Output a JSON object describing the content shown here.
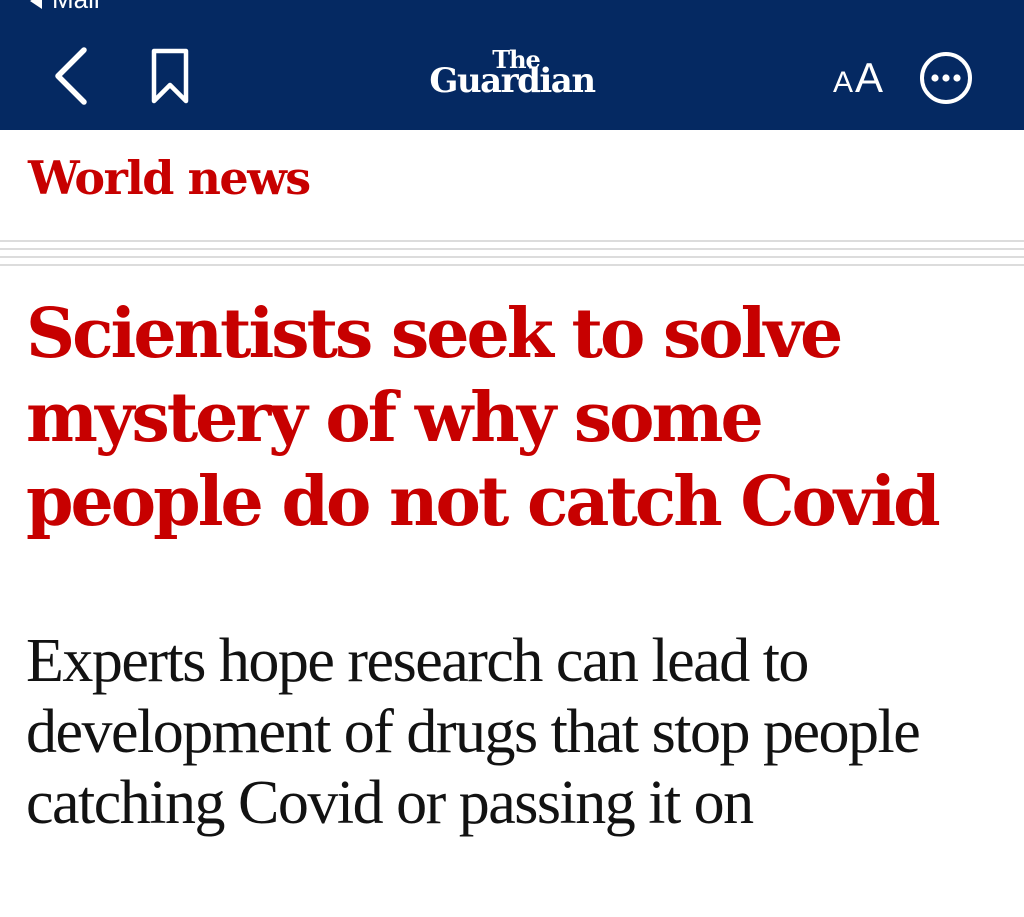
{
  "status_bar": {
    "back_label": "Mail"
  },
  "app_bar": {
    "logo": {
      "line1": "The",
      "line2": "Guardian"
    },
    "back_icon": "chevron-left-icon",
    "bookmark_icon": "bookmark-icon",
    "text_size": {
      "small": "A",
      "large": "A"
    },
    "more_icon": "ellipsis-circle-icon"
  },
  "article": {
    "section": "World news",
    "headline": "Scientists seek to solve mystery of why some people do not catch Covid",
    "standfirst": "Experts hope research can lead to development of drugs that stop people catching Covid or passing it on"
  },
  "colors": {
    "brand_navy": "#052962",
    "news_red": "#c70000",
    "body_text": "#121212",
    "rule": "#dcdcdc"
  }
}
